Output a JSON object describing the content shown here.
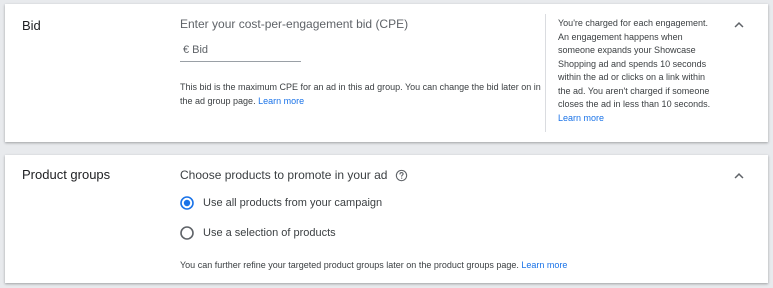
{
  "bid": {
    "title": "Bid",
    "field_label": "Enter your cost-per-engagement bid (CPE)",
    "currency_symbol": "€",
    "input_placeholder": "Bid",
    "help_text": "This bid is the maximum CPE for an ad in this ad group. You can change the bid later on in the ad group page.",
    "help_link": "Learn more",
    "side_note": "You're charged for each engagement. An engagement happens when someone expands your Showcase Shopping ad and spends 10 seconds within the ad or clicks on a link within the ad. You aren't charged if someone closes the ad in less than 10 seconds.",
    "side_note_link": "Learn more",
    "collapse_icon": "chevron-up-icon"
  },
  "product_groups": {
    "title": "Product groups",
    "prompt": "Choose products to promote in your ad",
    "help_icon": "help-circle-icon",
    "options": [
      {
        "label": "Use all products from your campaign",
        "selected": true
      },
      {
        "label": "Use a selection of products",
        "selected": false
      }
    ],
    "help_text": "You can further refine your targeted product groups later on the product groups page.",
    "help_link": "Learn more",
    "collapse_icon": "chevron-up-icon"
  },
  "colors": {
    "accent": "#1a73e8",
    "radio_unselected": "#5f6368",
    "divider": "#dadce0",
    "background": "#e8eaed"
  }
}
